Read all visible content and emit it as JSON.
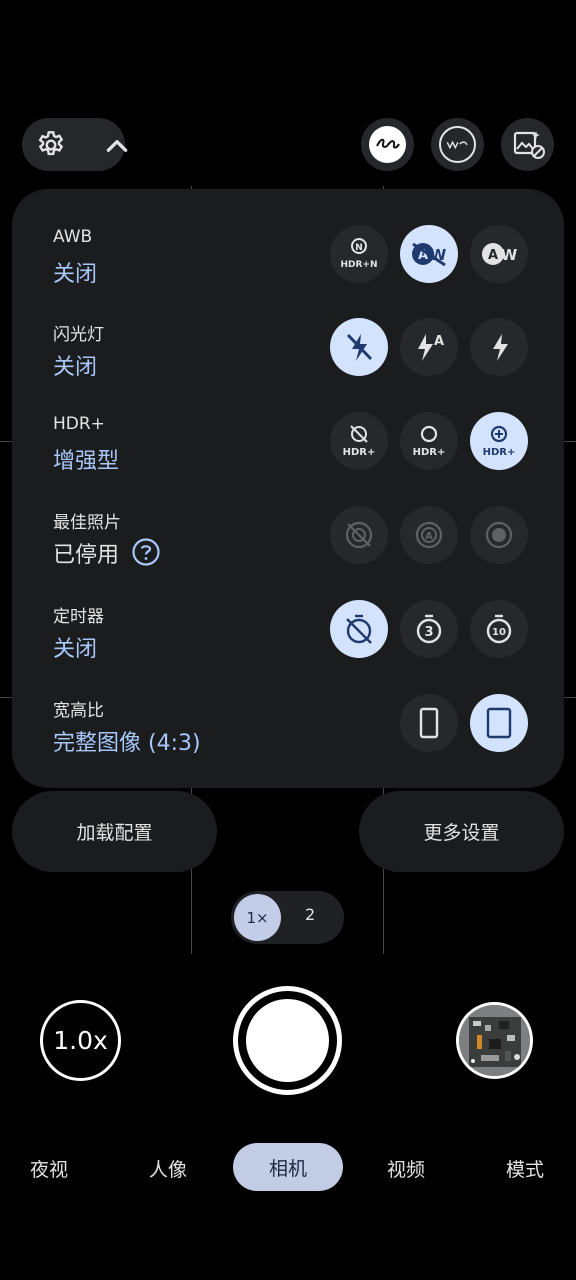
{
  "top_bar": {
    "settings_icon": "gear-icon",
    "collapse_icon": "chevron-up-icon",
    "buttons": [
      {
        "name": "leica-button",
        "icon": "leica-logo-icon"
      },
      {
        "name": "watermark-button",
        "icon": "watermark-icon"
      },
      {
        "name": "photo-effects-button",
        "icon": "image-sparkle-off-icon"
      }
    ]
  },
  "settings": {
    "awb": {
      "label": "AWB",
      "value": "关闭",
      "options": [
        "hdr-n-icon",
        "awb-off-icon",
        "awb-auto-icon"
      ],
      "selected": 1,
      "hdr_n_text": "HDR+N"
    },
    "flash": {
      "label": "闪光灯",
      "value": "关闭",
      "options": [
        "flash-off-icon",
        "flash-auto-icon",
        "flash-on-icon"
      ],
      "selected": 0
    },
    "hdr": {
      "label": "HDR+",
      "value": "增强型",
      "options": [
        "hdr-off-icon",
        "hdr-on-icon",
        "hdr-enhanced-icon"
      ],
      "selected": 2,
      "icon_text": "HDR+"
    },
    "best_shot": {
      "label": "最佳照片",
      "value": "已停用",
      "options": [
        "best-shot-off-icon",
        "best-shot-auto-icon",
        "best-shot-on-icon"
      ],
      "selected": -1
    },
    "timer": {
      "label": "定时器",
      "value": "关闭",
      "options": [
        "timer-off-icon",
        "timer-3-icon",
        "timer-10-icon"
      ],
      "selected": 0,
      "timer_3": "3",
      "timer_10": "10"
    },
    "aspect": {
      "label": "宽高比",
      "value": "完整图像 (4:3)",
      "options": [
        "aspect-tall-icon",
        "aspect-full-icon"
      ],
      "selected": 1
    }
  },
  "actions": {
    "load_config": "加载配置",
    "more_settings": "更多设置"
  },
  "zoom": {
    "option_1": "1×",
    "option_2": "2",
    "current": "1.0x"
  },
  "modes": {
    "night": "夜视",
    "portrait": "人像",
    "camera": "相机",
    "video": "视频",
    "more": "模式"
  },
  "colors": {
    "accent": "#a8c7fa",
    "selected_bg": "#d3e3fd",
    "panel_bg": "#1b1c1e"
  }
}
